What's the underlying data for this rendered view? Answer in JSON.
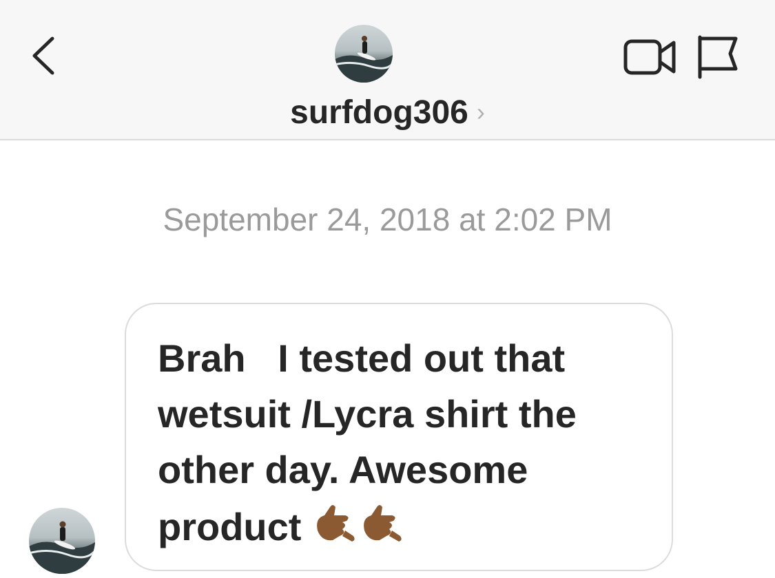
{
  "header": {
    "username": "surfdog306",
    "chevron": "›",
    "icons": {
      "back": "chevron-left-icon",
      "video": "video-call-icon",
      "flag": "flag-icon"
    }
  },
  "conversation": {
    "timestamp": "September 24, 2018 at 2:02 PM",
    "messages": [
      {
        "text": "Brah   I tested out that wetsuit /Lycra shirt the other day. Awesome product ",
        "emoji": [
          "call-me-hand-medium-dark",
          "call-me-hand-medium-dark"
        ]
      }
    ]
  },
  "colors": {
    "header_bg": "#f7f7f7",
    "divider": "#dbdbdb",
    "text": "#262626",
    "timestamp": "#9a9a9a",
    "emoji_skin": "#8b5a32"
  }
}
